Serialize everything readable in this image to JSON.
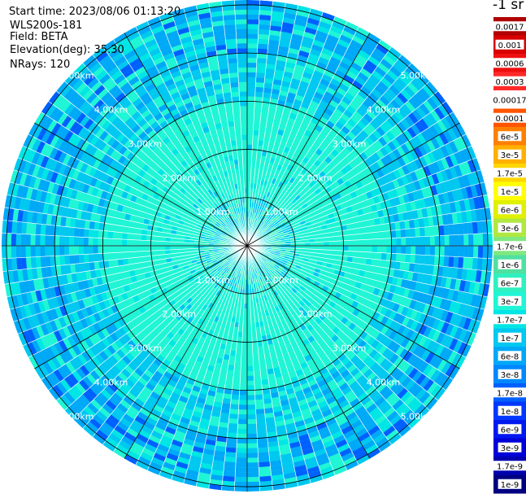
{
  "header": {
    "start_time": "Start time: 2023/08/06 01:13:20",
    "instrument": "WLS200s-181",
    "field": "Field: BETA",
    "elevation": "Elevation(deg): 35.30",
    "nrays": "NRays: 120"
  },
  "colorbar": {
    "unit_label": "-1 sr",
    "segments": [
      {
        "label": "0.0017",
        "color": "#b00000"
      },
      {
        "label": "0.001",
        "color": "#d80000"
      },
      {
        "label": "0.0006",
        "color": "#ee1010"
      },
      {
        "label": "0.0003",
        "color": "#ff2a2a"
      },
      {
        "label": "0.00017",
        "color": "#ffffff"
      },
      {
        "label": "0.0001",
        "color": "#ff5500"
      },
      {
        "label": "6e-5",
        "color": "#ff8000"
      },
      {
        "label": "3e-5",
        "color": "#ffb000"
      },
      {
        "label": "1.7e-5",
        "color": "#ffd700"
      },
      {
        "label": "1e-5",
        "color": "#ffff00"
      },
      {
        "label": "6e-6",
        "color": "#e0f000"
      },
      {
        "label": "3e-6",
        "color": "#b0e840"
      },
      {
        "label": "1.7e-6",
        "color": "#80e880"
      },
      {
        "label": "1e-6",
        "color": "#50e0a0"
      },
      {
        "label": "6e-7",
        "color": "#30f0c0"
      },
      {
        "label": "3e-7",
        "color": "#20f5d5"
      },
      {
        "label": "1.7e-7",
        "color": "#00e5e5"
      },
      {
        "label": "1e-7",
        "color": "#00c8f0"
      },
      {
        "label": "6e-8",
        "color": "#00a8f8"
      },
      {
        "label": "3e-8",
        "color": "#0088ff"
      },
      {
        "label": "1.7e-8",
        "color": "#0060ff"
      },
      {
        "label": "1e-8",
        "color": "#0038ff"
      },
      {
        "label": "6e-9",
        "color": "#0018f0"
      },
      {
        "label": "3e-9",
        "color": "#0000d8"
      },
      {
        "label": "1.7e-9",
        "color": "#0000b0"
      },
      {
        "label": "1e-9",
        "color": "#000080"
      }
    ]
  },
  "chart_data": {
    "type": "heatmap",
    "projection": "polar (PPI)",
    "rays": 120,
    "range_rings_km": [
      1,
      2,
      3,
      4,
      5
    ],
    "ring_labels": [
      "1.00km",
      "2.00km",
      "3.00km",
      "4.00km",
      "5.00km"
    ],
    "spokes_deg": [
      0,
      30,
      60,
      90,
      120,
      150,
      180,
      210,
      240,
      270,
      300,
      330
    ],
    "max_range_km": 5.1,
    "field": "BETA",
    "dominant_values": "1e-7 to 6e-7 inside 3 km; 3e-8 to 1e-7 beyond 3 km",
    "colors": {
      "background_field": "#20f5d5",
      "near": "#30f0c0",
      "mid": "#00c8f0",
      "far": "#00a8f8",
      "speckle_dark": "#0060ff",
      "speckle_light": "#00e5e5",
      "ring_line": "#000000",
      "ray_separator": "#ffffff"
    }
  }
}
